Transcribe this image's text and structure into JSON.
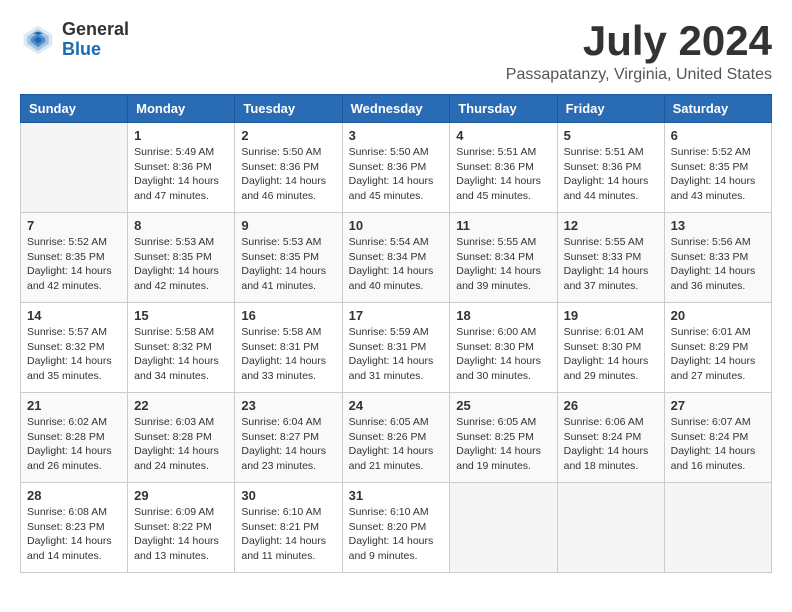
{
  "logo": {
    "general": "General",
    "blue": "Blue"
  },
  "title": "July 2024",
  "location": "Passapatanzy, Virginia, United States",
  "days_of_week": [
    "Sunday",
    "Monday",
    "Tuesday",
    "Wednesday",
    "Thursday",
    "Friday",
    "Saturday"
  ],
  "weeks": [
    [
      {
        "day": "",
        "info": ""
      },
      {
        "day": "1",
        "info": "Sunrise: 5:49 AM\nSunset: 8:36 PM\nDaylight: 14 hours\nand 47 minutes."
      },
      {
        "day": "2",
        "info": "Sunrise: 5:50 AM\nSunset: 8:36 PM\nDaylight: 14 hours\nand 46 minutes."
      },
      {
        "day": "3",
        "info": "Sunrise: 5:50 AM\nSunset: 8:36 PM\nDaylight: 14 hours\nand 45 minutes."
      },
      {
        "day": "4",
        "info": "Sunrise: 5:51 AM\nSunset: 8:36 PM\nDaylight: 14 hours\nand 45 minutes."
      },
      {
        "day": "5",
        "info": "Sunrise: 5:51 AM\nSunset: 8:36 PM\nDaylight: 14 hours\nand 44 minutes."
      },
      {
        "day": "6",
        "info": "Sunrise: 5:52 AM\nSunset: 8:35 PM\nDaylight: 14 hours\nand 43 minutes."
      }
    ],
    [
      {
        "day": "7",
        "info": "Sunrise: 5:52 AM\nSunset: 8:35 PM\nDaylight: 14 hours\nand 42 minutes."
      },
      {
        "day": "8",
        "info": "Sunrise: 5:53 AM\nSunset: 8:35 PM\nDaylight: 14 hours\nand 42 minutes."
      },
      {
        "day": "9",
        "info": "Sunrise: 5:53 AM\nSunset: 8:35 PM\nDaylight: 14 hours\nand 41 minutes."
      },
      {
        "day": "10",
        "info": "Sunrise: 5:54 AM\nSunset: 8:34 PM\nDaylight: 14 hours\nand 40 minutes."
      },
      {
        "day": "11",
        "info": "Sunrise: 5:55 AM\nSunset: 8:34 PM\nDaylight: 14 hours\nand 39 minutes."
      },
      {
        "day": "12",
        "info": "Sunrise: 5:55 AM\nSunset: 8:33 PM\nDaylight: 14 hours\nand 37 minutes."
      },
      {
        "day": "13",
        "info": "Sunrise: 5:56 AM\nSunset: 8:33 PM\nDaylight: 14 hours\nand 36 minutes."
      }
    ],
    [
      {
        "day": "14",
        "info": "Sunrise: 5:57 AM\nSunset: 8:32 PM\nDaylight: 14 hours\nand 35 minutes."
      },
      {
        "day": "15",
        "info": "Sunrise: 5:58 AM\nSunset: 8:32 PM\nDaylight: 14 hours\nand 34 minutes."
      },
      {
        "day": "16",
        "info": "Sunrise: 5:58 AM\nSunset: 8:31 PM\nDaylight: 14 hours\nand 33 minutes."
      },
      {
        "day": "17",
        "info": "Sunrise: 5:59 AM\nSunset: 8:31 PM\nDaylight: 14 hours\nand 31 minutes."
      },
      {
        "day": "18",
        "info": "Sunrise: 6:00 AM\nSunset: 8:30 PM\nDaylight: 14 hours\nand 30 minutes."
      },
      {
        "day": "19",
        "info": "Sunrise: 6:01 AM\nSunset: 8:30 PM\nDaylight: 14 hours\nand 29 minutes."
      },
      {
        "day": "20",
        "info": "Sunrise: 6:01 AM\nSunset: 8:29 PM\nDaylight: 14 hours\nand 27 minutes."
      }
    ],
    [
      {
        "day": "21",
        "info": "Sunrise: 6:02 AM\nSunset: 8:28 PM\nDaylight: 14 hours\nand 26 minutes."
      },
      {
        "day": "22",
        "info": "Sunrise: 6:03 AM\nSunset: 8:28 PM\nDaylight: 14 hours\nand 24 minutes."
      },
      {
        "day": "23",
        "info": "Sunrise: 6:04 AM\nSunset: 8:27 PM\nDaylight: 14 hours\nand 23 minutes."
      },
      {
        "day": "24",
        "info": "Sunrise: 6:05 AM\nSunset: 8:26 PM\nDaylight: 14 hours\nand 21 minutes."
      },
      {
        "day": "25",
        "info": "Sunrise: 6:05 AM\nSunset: 8:25 PM\nDaylight: 14 hours\nand 19 minutes."
      },
      {
        "day": "26",
        "info": "Sunrise: 6:06 AM\nSunset: 8:24 PM\nDaylight: 14 hours\nand 18 minutes."
      },
      {
        "day": "27",
        "info": "Sunrise: 6:07 AM\nSunset: 8:24 PM\nDaylight: 14 hours\nand 16 minutes."
      }
    ],
    [
      {
        "day": "28",
        "info": "Sunrise: 6:08 AM\nSunset: 8:23 PM\nDaylight: 14 hours\nand 14 minutes."
      },
      {
        "day": "29",
        "info": "Sunrise: 6:09 AM\nSunset: 8:22 PM\nDaylight: 14 hours\nand 13 minutes."
      },
      {
        "day": "30",
        "info": "Sunrise: 6:10 AM\nSunset: 8:21 PM\nDaylight: 14 hours\nand 11 minutes."
      },
      {
        "day": "31",
        "info": "Sunrise: 6:10 AM\nSunset: 8:20 PM\nDaylight: 14 hours\nand 9 minutes."
      },
      {
        "day": "",
        "info": ""
      },
      {
        "day": "",
        "info": ""
      },
      {
        "day": "",
        "info": ""
      }
    ]
  ]
}
